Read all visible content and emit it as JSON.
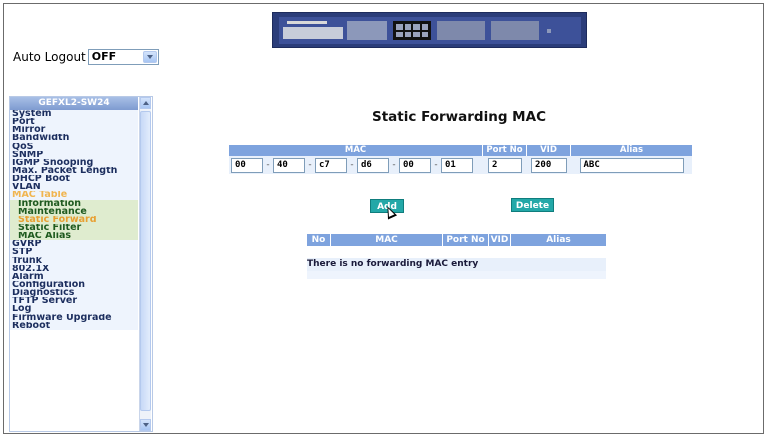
{
  "auto_logout": {
    "label": "Auto Logout",
    "value": "OFF"
  },
  "sidebar": {
    "title": "GEFXL2-SW24",
    "items": [
      {
        "label": "System"
      },
      {
        "label": "Port"
      },
      {
        "label": "Mirror"
      },
      {
        "label": "Bandwidth"
      },
      {
        "label": "QoS"
      },
      {
        "label": "SNMP"
      },
      {
        "label": "IGMP Snooping"
      },
      {
        "label": "Max. Packet Length"
      },
      {
        "label": "DHCP Boot"
      },
      {
        "label": "VLAN"
      },
      {
        "label": "MAC Table"
      },
      {
        "label": "Information"
      },
      {
        "label": "Maintenance"
      },
      {
        "label": "Static Forward"
      },
      {
        "label": "Static Filter"
      },
      {
        "label": "MAC Alias"
      },
      {
        "label": "GVRP"
      },
      {
        "label": "STP"
      },
      {
        "label": "Trunk"
      },
      {
        "label": "802.1X"
      },
      {
        "label": "Alarm"
      },
      {
        "label": "Configuration"
      },
      {
        "label": "Diagnostics"
      },
      {
        "label": "TFTP Server"
      },
      {
        "label": "Log"
      },
      {
        "label": "Firmware Upgrade"
      },
      {
        "label": "Reboot"
      }
    ]
  },
  "main": {
    "title": "Static Forwarding MAC",
    "form": {
      "headers": [
        "MAC",
        "Port No",
        "VID",
        "Alias"
      ],
      "mac": [
        "00",
        "40",
        "c7",
        "d6",
        "00",
        "01"
      ],
      "port_no": "2",
      "vid": "200",
      "alias": "ABC"
    },
    "buttons": {
      "add": "Add",
      "delete": "Delete"
    },
    "list": {
      "headers": [
        "No",
        "MAC",
        "Port No",
        "VID",
        "Alias"
      ],
      "empty_message": "There is no forwarding MAC entry"
    }
  },
  "colors": {
    "header_blue": "#7ea3de",
    "button_teal": "#23a8a8",
    "active_item": "#e8a032"
  }
}
